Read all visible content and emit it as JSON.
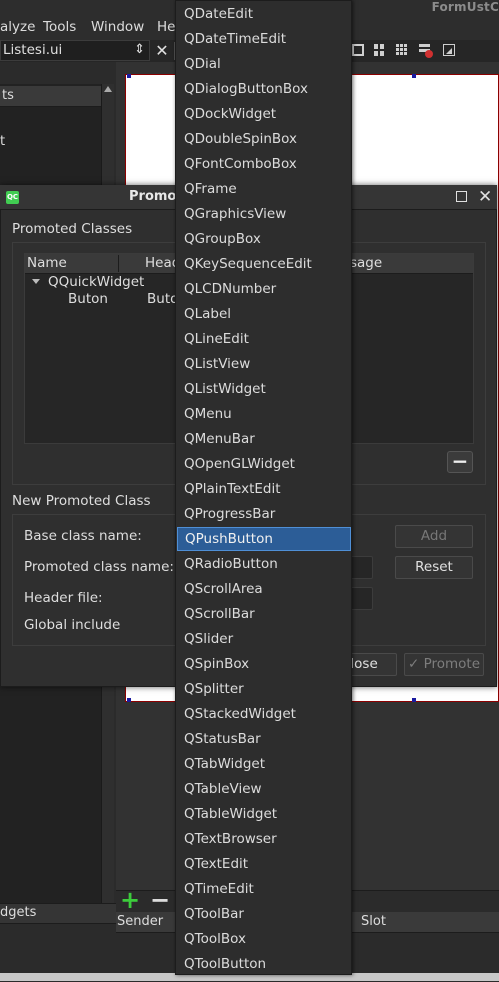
{
  "window": {
    "title_partial": "FormUstC"
  },
  "menubar": {
    "items": [
      {
        "label": "alyze"
      },
      {
        "label": "Tools"
      },
      {
        "label": "Window"
      },
      {
        "label": "He"
      }
    ]
  },
  "toolbar": {
    "file_combo_value": "Listesi.ui",
    "file_combo_arrow": "⇕",
    "close_glyph": "✕"
  },
  "left_panel": {
    "object_header": "ts",
    "item": "t",
    "widgets_header": "dgets"
  },
  "signals_panel": {
    "add_glyph": "+",
    "remove_glyph": "−",
    "columns": [
      "Sender",
      "Slot"
    ]
  },
  "dialog": {
    "icon_text": "QC",
    "title": "Promot",
    "maximize_glyph": "□",
    "close_glyph": "✕",
    "promoted_classes": {
      "group_label": "Promoted Classes",
      "columns": [
        "Name",
        "Head",
        "sage"
      ],
      "rows": [
        {
          "name": "QQuickWidget",
          "header": ""
        },
        {
          "name": "Buton",
          "header": "Buto"
        }
      ],
      "remove_glyph": "−"
    },
    "new_promoted_class": {
      "group_label": "New Promoted Class",
      "base_class_label": "Base class name:",
      "promoted_class_label": "Promoted class name:",
      "header_file_label": "Header file:",
      "global_include_label": "Global include",
      "add_button": "Add",
      "reset_button": "Reset"
    },
    "close_button": "Close",
    "promote_button": "Promote",
    "promote_check_glyph": "✓"
  },
  "popup": {
    "selected": "QPushButton",
    "options": [
      "QDateEdit",
      "QDateTimeEdit",
      "QDial",
      "QDialogButtonBox",
      "QDockWidget",
      "QDoubleSpinBox",
      "QFontComboBox",
      "QFrame",
      "QGraphicsView",
      "QGroupBox",
      "QKeySequenceEdit",
      "QLCDNumber",
      "QLabel",
      "QLineEdit",
      "QListView",
      "QListWidget",
      "QMenu",
      "QMenuBar",
      "QOpenGLWidget",
      "QPlainTextEdit",
      "QProgressBar",
      "QPushButton",
      "QRadioButton",
      "QScrollArea",
      "QScrollBar",
      "QSlider",
      "QSpinBox",
      "QSplitter",
      "QStackedWidget",
      "QStatusBar",
      "QTabWidget",
      "QTableView",
      "QTableWidget",
      "QTextBrowser",
      "QTextEdit",
      "QTimeEdit",
      "QToolBar",
      "QToolBox",
      "QToolButton"
    ]
  },
  "colors": {
    "selection": "#2c5d97",
    "add_green": "#3ccc3c",
    "qt_green": "#41cd52"
  }
}
